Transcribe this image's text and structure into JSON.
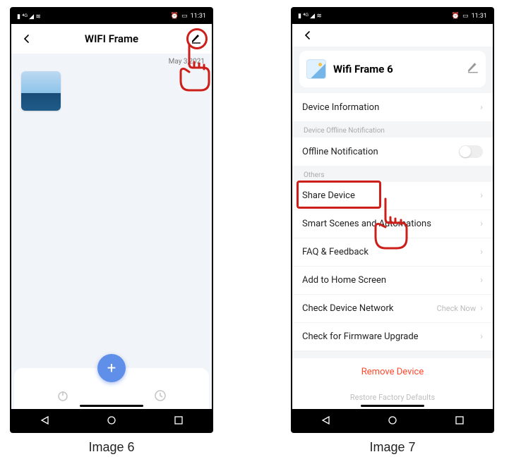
{
  "status": {
    "carrier_icons": "▮ ⁴ᴳ ◢ ≋",
    "alarm_icon": "⏰",
    "battery_icon": "▭",
    "time": "11:31"
  },
  "screen1": {
    "title": "WIFI Frame",
    "date": "May 3,2021",
    "fab_label": "+",
    "caption": "Image 6"
  },
  "screen2": {
    "device_name": "Wifi Frame 6",
    "rows": {
      "device_info": "Device Information",
      "offline_section": "Device Offline Notification",
      "offline_notif": "Offline Notification",
      "others_section": "Others",
      "share_device": "Share Device",
      "smart_scenes": "Smart Scenes and Automations",
      "faq": "FAQ & Feedback",
      "add_home": "Add to Home Screen",
      "check_net": "Check Device Network",
      "check_net_aux": "Check Now",
      "firmware": "Check for Firmware Upgrade",
      "remove": "Remove Device",
      "restore": "Restore Factory Defaults"
    },
    "caption": "Image 7"
  },
  "highlight_color": "#cc1f1a"
}
